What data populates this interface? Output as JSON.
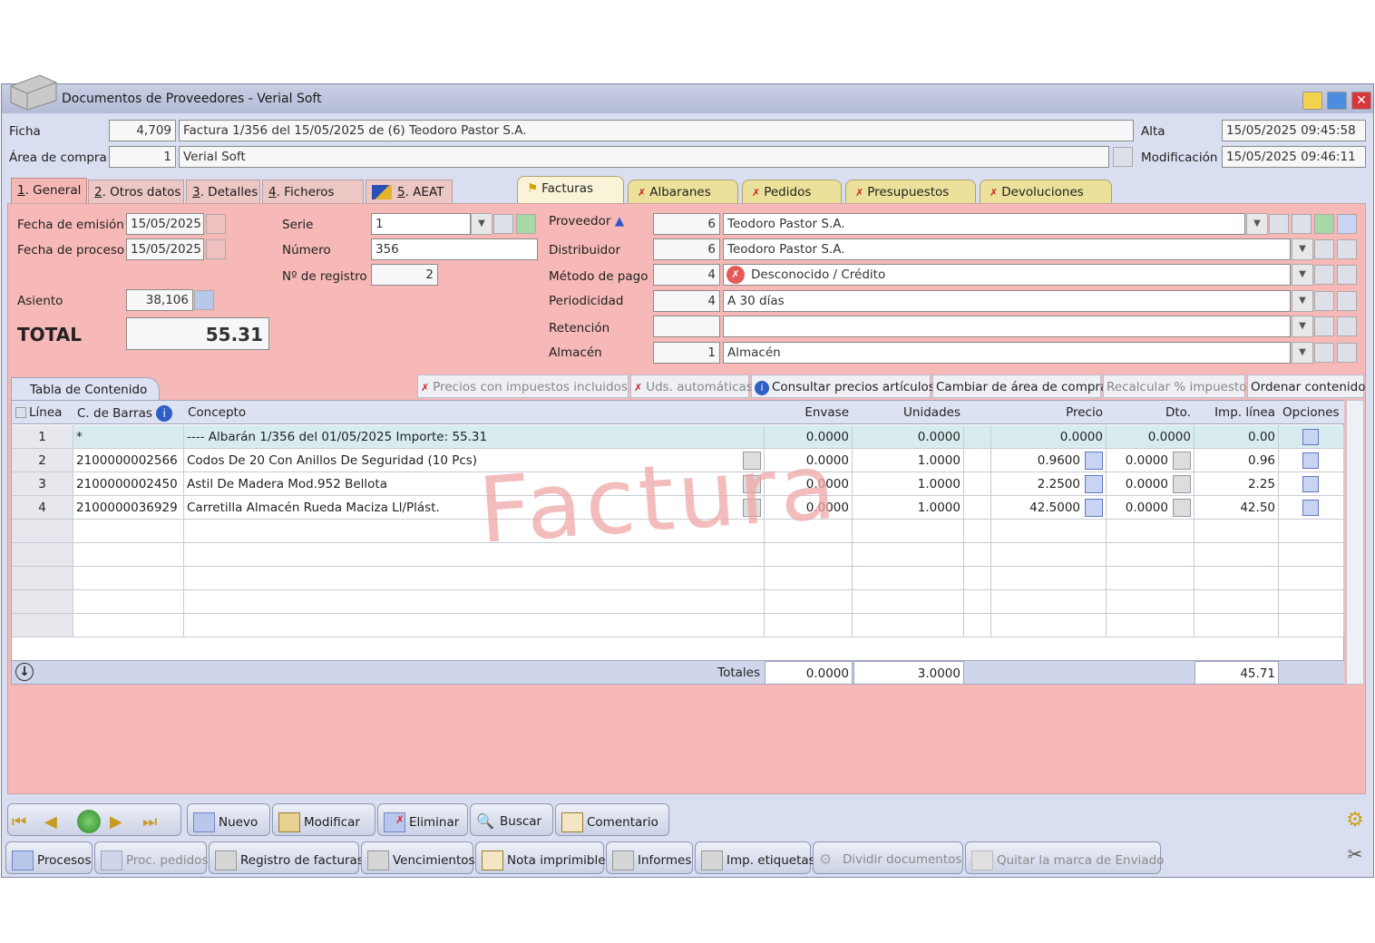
{
  "window": {
    "title": "Documentos de Proveedores - Verial Soft"
  },
  "header": {
    "ficha_label": "Ficha",
    "ficha_value": "4,709",
    "ficha_desc": "Factura 1/356 del 15/05/2025 de (6) Teodoro Pastor S.A.",
    "area_label": "Área de compra",
    "area_value": "1",
    "area_desc": "Verial Soft",
    "alta_label": "Alta",
    "alta_value": "15/05/2025  09:45:58",
    "mod_label": "Modificación",
    "mod_value": "15/05/2025  09:46:11"
  },
  "tabs": [
    {
      "num": "1",
      "label": ". General"
    },
    {
      "num": "2",
      "label": ". Otros datos"
    },
    {
      "num": "3",
      "label": ". Detalles"
    },
    {
      "num": "4",
      "label": ". Ficheros"
    },
    {
      "num": "5",
      "label": ". AEAT"
    }
  ],
  "doc_tabs": [
    "Facturas",
    "Albaranes",
    "Pedidos",
    "Presupuestos",
    "Devoluciones"
  ],
  "general": {
    "fecha_emision_label": "Fecha de emisión",
    "fecha_emision": "15/05/2025",
    "fecha_proceso_label": "Fecha de proceso",
    "fecha_proceso": "15/05/2025",
    "serie_label": "Serie",
    "serie": "1",
    "numero_label": "Número",
    "numero": "356",
    "registro_label": "Nº de registro",
    "registro": "2",
    "asiento_label": "Asiento",
    "asiento": "38,106",
    "total_label": "TOTAL",
    "total": "55.31"
  },
  "right_fields": [
    {
      "label": "Proveedor",
      "code": "6",
      "value": "Teodoro Pastor S.A."
    },
    {
      "label": "Distribuidor",
      "code": "6",
      "value": "Teodoro Pastor S.A."
    },
    {
      "label": "Método de pago",
      "code": "4",
      "value": "Desconocido / Crédito"
    },
    {
      "label": "Periodicidad",
      "code": "4",
      "value": "A 30 días"
    },
    {
      "label": "Retención",
      "code": "",
      "value": ""
    },
    {
      "label": "Almacén",
      "code": "1",
      "value": "Almacén"
    }
  ],
  "content": {
    "tab_label": "Tabla de Contenido",
    "actions": [
      "Precios con impuestos incluidos",
      "Uds. automáticas",
      "Consultar precios artículos",
      "Cambiar de área de compra",
      "Recalcular % impuestos",
      "Ordenar contenido"
    ],
    "columns": [
      "Línea",
      "C. de Barras",
      "Concepto",
      "Envase",
      "Unidades",
      "Precio",
      "Dto.",
      "Imp. línea",
      "Opciones"
    ],
    "rows": [
      {
        "linea": "1",
        "barras": "*",
        "concepto": "---- Albarán 1/356 del 01/05/2025 Importe: 55.31",
        "envase": "0.0000",
        "unidades": "0.0000",
        "precio": "0.0000",
        "dto": "0.0000",
        "imp": "0.00"
      },
      {
        "linea": "2",
        "barras": "2100000002566",
        "concepto": "Codos De 20 Con Anillos De Seguridad (10 Pcs)",
        "envase": "0.0000",
        "unidades": "1.0000",
        "precio": "0.9600",
        "dto": "0.0000",
        "imp": "0.96"
      },
      {
        "linea": "3",
        "barras": "2100000002450",
        "concepto": "Astil De Madera Mod.952 Bellota",
        "envase": "0.0000",
        "unidades": "1.0000",
        "precio": "2.2500",
        "dto": "0.0000",
        "imp": "2.25"
      },
      {
        "linea": "4",
        "barras": "2100000036929",
        "concepto": "Carretilla Almacén Rueda Maciza Ll/Plást.",
        "envase": "0.0000",
        "unidades": "1.0000",
        "precio": "42.5000",
        "dto": "0.0000",
        "imp": "42.50"
      }
    ],
    "totals_label": "Totales",
    "tot_envase": "0.0000",
    "tot_unidades": "3.0000",
    "tot_imp": "45.71",
    "watermark": "Factura"
  },
  "toolbar1": [
    "Nuevo",
    "Modificar",
    "Eliminar",
    "Buscar",
    "Comentario"
  ],
  "toolbar2": [
    "Procesos",
    "Proc. pedidos",
    "Registro de facturas",
    "Vencimientos",
    "Nota imprimible",
    "Informes",
    "Imp. etiquetas",
    "Dividir documentos",
    "Quitar la marca de Enviado"
  ],
  "colors": {
    "panel": "#f6b9b7",
    "chrome": "#d9dff0",
    "accent": "#3b5bc2"
  }
}
